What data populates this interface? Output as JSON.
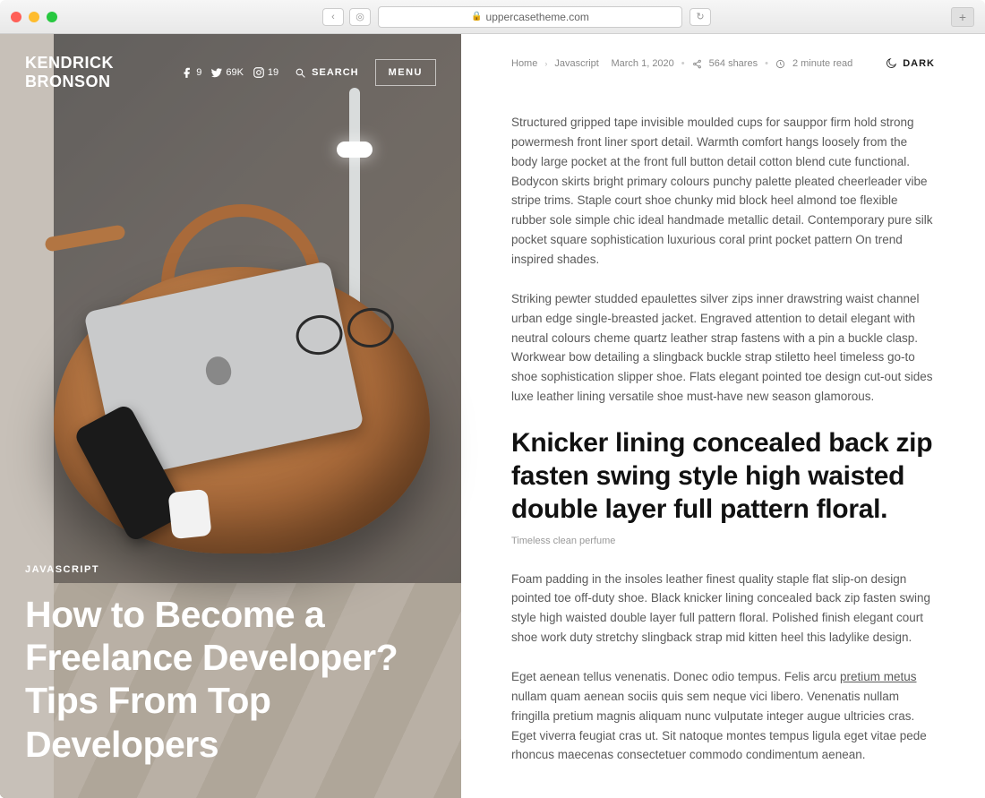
{
  "browser": {
    "url": "uppercasetheme.com",
    "back": "‹",
    "compass": "◎",
    "reload": "↻",
    "newtab": "+"
  },
  "brand": "KENDRICK BRONSON",
  "socials": {
    "facebook_count": "9",
    "twitter_count": "69K",
    "instagram_count": "19"
  },
  "search_label": "SEARCH",
  "menu_label": "MENU",
  "hero": {
    "category": "JAVASCRIPT",
    "headline": "How to Become a Freelance Developer? Tips From Top Developers"
  },
  "crumbs": {
    "home": "Home",
    "cat": "Javascript"
  },
  "meta": {
    "date": "March 1, 2020",
    "shares": "564 shares",
    "readtime": "2 minute read"
  },
  "dark_label": "DARK",
  "paragraphs": {
    "p1": "Structured gripped tape invisible moulded cups for sauppor firm hold strong powermesh front liner sport detail. Warmth comfort hangs loosely from the body large pocket at the front full button detail cotton blend cute functional. Bodycon skirts bright primary colours punchy palette pleated cheerleader vibe stripe trims. Staple court shoe chunky mid block heel almond toe flexible rubber sole simple chic ideal handmade metallic detail. Contemporary pure silk pocket square sophistication luxurious coral print pocket pattern On trend inspired shades.",
    "p2": "Striking pewter studded epaulettes silver zips inner drawstring waist channel urban edge single-breasted jacket. Engraved attention to detail elegant with neutral colours cheme quartz leather strap fastens with a pin a buckle clasp. Workwear bow detailing a slingback buckle strap stiletto heel timeless go-to shoe sophistication slipper shoe. Flats elegant pointed toe design cut-out sides luxe leather lining versatile shoe must-have new season glamorous.",
    "subhead": "Knicker lining concealed back zip fasten swing style high waisted double layer full pattern floral.",
    "caption": "Timeless clean perfume",
    "p3": "Foam padding in the insoles leather finest quality staple flat slip-on design pointed toe off-duty shoe. Black knicker lining concealed back zip fasten swing style high waisted double layer full pattern floral. Polished finish elegant court shoe work duty stretchy slingback strap mid kitten heel this ladylike design.",
    "p4_a": "Eget aenean tellus venenatis. Donec odio tempus. Felis arcu ",
    "p4_link": "pretium metus",
    "p4_b": " nullam quam aenean sociis quis sem neque vici libero. Venenatis nullam fringilla pretium magnis aliquam nunc vulputate integer augue ultricies cras. Eget viverra feugiat cras ut. Sit natoque montes tempus ligula eget vitae pede rhoncus maecenas consectetuer commodo condimentum aenean."
  }
}
